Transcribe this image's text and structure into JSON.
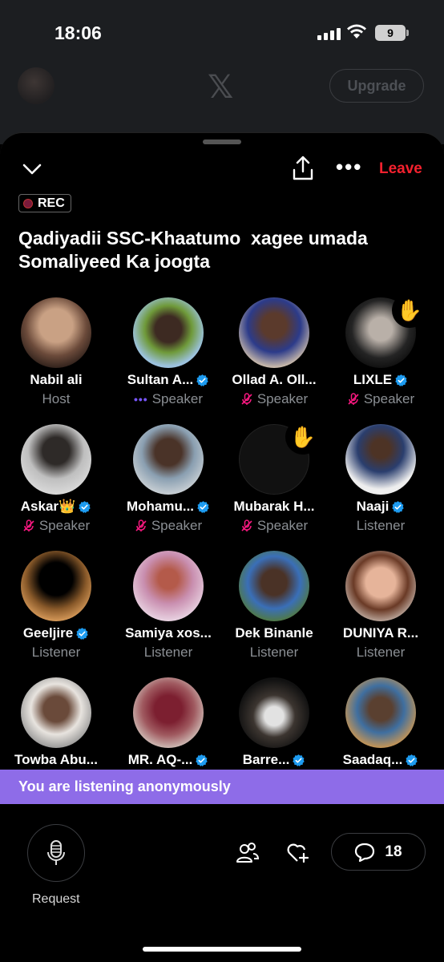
{
  "status": {
    "time": "18:06",
    "battery": "9"
  },
  "background": {
    "upgrade_label": "Upgrade"
  },
  "space": {
    "rec_label": "REC",
    "title": "Qadiyadii SSC-Khaatumo  xagee umada\nSomaliyeed Ka joogta",
    "leave_label": "Leave"
  },
  "participants": [
    {
      "name": "Nabil ali",
      "role": "Host",
      "verified": false,
      "mic_off": false
    },
    {
      "name": "Sultan A...",
      "role": "Speaker",
      "verified": true,
      "mic_off": false,
      "speaking": true
    },
    {
      "name": "Ollad A. Oll...",
      "role": "Speaker",
      "verified": false,
      "mic_off": true
    },
    {
      "name": "LIXLE",
      "role": "Speaker",
      "verified": true,
      "mic_off": true,
      "hand_raised": true
    },
    {
      "name": "Askar👑",
      "role": "Speaker",
      "verified": true,
      "mic_off": true
    },
    {
      "name": "Mohamu...",
      "role": "Speaker",
      "verified": true,
      "mic_off": true
    },
    {
      "name": "Mubarak H...",
      "role": "Speaker",
      "verified": false,
      "mic_off": true,
      "hand_raised": true
    },
    {
      "name": "Naaji",
      "role": "Listener",
      "verified": true,
      "mic_off": false
    },
    {
      "name": "Geeljire",
      "role": "Listener",
      "verified": true,
      "mic_off": false
    },
    {
      "name": "Samiya xos...",
      "role": "Listener",
      "verified": false,
      "mic_off": false
    },
    {
      "name": "Dek Binanle",
      "role": "Listener",
      "verified": false,
      "mic_off": false
    },
    {
      "name": "DUNIYA R...",
      "role": "Listener",
      "verified": false,
      "mic_off": false
    },
    {
      "name": "Towba Abu...",
      "role": "",
      "verified": false,
      "mic_off": false
    },
    {
      "name": "MR. AQ-...",
      "role": "",
      "verified": true,
      "mic_off": false
    },
    {
      "name": "Barre...",
      "role": "",
      "verified": true,
      "mic_off": false
    },
    {
      "name": "Saadaq...",
      "role": "",
      "verified": true,
      "mic_off": false
    }
  ],
  "banner": {
    "text": "You are listening anonymously"
  },
  "bottom": {
    "request_label": "Request",
    "comment_count": "18"
  },
  "colors": {
    "accent": "#8e6ce8",
    "leave": "#f4212e",
    "verified": "#1d9bf0",
    "mic_off": "#f91880"
  },
  "icons": [
    "chevron-down-icon",
    "share-icon",
    "more-icon",
    "wifi-icon",
    "verified-icon",
    "mic-off-icon",
    "raised-hand-icon",
    "microphone-icon",
    "people-icon",
    "heart-plus-icon",
    "comment-icon"
  ]
}
